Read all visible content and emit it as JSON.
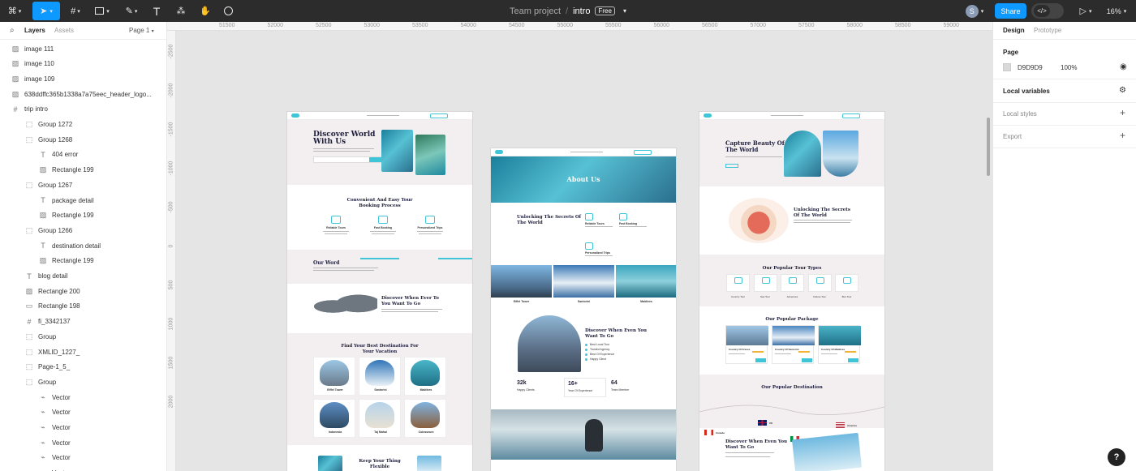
{
  "topbar": {
    "project": "Team project",
    "separator": "/",
    "file": "intro",
    "plan_badge": "Free",
    "avatar_initial": "S",
    "share": "Share",
    "zoom": "16%"
  },
  "left": {
    "tabs": {
      "layers": "Layers",
      "assets": "Assets"
    },
    "page_selector": "Page 1",
    "layers": [
      {
        "name": "image 111",
        "icon": "image-icon",
        "indent": 0
      },
      {
        "name": "image 110",
        "icon": "image-icon",
        "indent": 0
      },
      {
        "name": "image 109",
        "icon": "image-icon",
        "indent": 0
      },
      {
        "name": "638ddffc365b1338a7a75eec_header_logo...",
        "icon": "image-icon",
        "indent": 0
      },
      {
        "name": "trip intro",
        "icon": "frame-icon",
        "indent": 0
      },
      {
        "name": "Group 1272",
        "icon": "group-icon",
        "indent": 1
      },
      {
        "name": "Group 1268",
        "icon": "group-icon",
        "indent": 1
      },
      {
        "name": "404 error",
        "icon": "text-icon",
        "indent": 2
      },
      {
        "name": "Rectangle 199",
        "icon": "image-icon",
        "indent": 2
      },
      {
        "name": "Group 1267",
        "icon": "group-icon",
        "indent": 1
      },
      {
        "name": "package detail",
        "icon": "text-icon",
        "indent": 2
      },
      {
        "name": "Rectangle 199",
        "icon": "image-icon",
        "indent": 2
      },
      {
        "name": "Group 1266",
        "icon": "group-icon",
        "indent": 1
      },
      {
        "name": "destination detail",
        "icon": "text-icon",
        "indent": 2
      },
      {
        "name": "Rectangle 199",
        "icon": "image-icon",
        "indent": 2
      },
      {
        "name": "blog detail",
        "icon": "text-icon",
        "indent": 1
      },
      {
        "name": "Rectangle 200",
        "icon": "image-icon",
        "indent": 1
      },
      {
        "name": "Rectangle 198",
        "icon": "rectangle-icon",
        "indent": 1
      },
      {
        "name": "fi_3342137",
        "icon": "frame-icon",
        "indent": 1
      },
      {
        "name": "Group",
        "icon": "group-icon",
        "indent": 1
      },
      {
        "name": "XMLID_1227_",
        "icon": "group-icon",
        "indent": 1
      },
      {
        "name": "Page-1_5_",
        "icon": "group-icon",
        "indent": 1
      },
      {
        "name": "Group",
        "icon": "group-icon",
        "indent": 1
      },
      {
        "name": "Vector",
        "icon": "vector-icon",
        "indent": 2
      },
      {
        "name": "Vector",
        "icon": "vector-icon",
        "indent": 2
      },
      {
        "name": "Vector",
        "icon": "vector-icon",
        "indent": 2
      },
      {
        "name": "Vector",
        "icon": "vector-icon",
        "indent": 2
      },
      {
        "name": "Vector",
        "icon": "vector-icon",
        "indent": 2
      },
      {
        "name": "Vector",
        "icon": "vector-icon",
        "indent": 2
      }
    ]
  },
  "right": {
    "tabs": {
      "design": "Design",
      "prototype": "Prototype"
    },
    "page_label": "Page",
    "page_color_hex": "D9D9D9",
    "page_opacity": "100%",
    "local_variables": "Local variables",
    "local_styles": "Local styles",
    "export": "Export"
  },
  "ruler": {
    "top": [
      "51500",
      "52000",
      "52500",
      "53000",
      "53500",
      "54000",
      "54500",
      "55000",
      "55500",
      "56000",
      "56500",
      "57000",
      "57500",
      "58000",
      "58500",
      "59000"
    ],
    "left": [
      "-2500",
      "-2000",
      "-1500",
      "-1000",
      "-500",
      "0",
      "500",
      "1000",
      "1500",
      "2000"
    ]
  },
  "frame1": {
    "hero_title": "Discover World With Us",
    "booking_title": "Convenient And Easy Tour Booking Process",
    "booking_items": [
      "Reliable Tours",
      "Fast Booking",
      "Personalized Trips"
    ],
    "our_word": "Our Word",
    "discover_title": "Discover When Ever To You Want To Go",
    "best_dest_title": "Find Your Best Destination For Your Vacation",
    "destinations": [
      "Eiffel Tower",
      "Santorini",
      "Maldives",
      "Indonesia",
      "Taj Mahal",
      "Colosseum"
    ],
    "keep_title": "Keep Your Thing Flexible"
  },
  "frame2": {
    "banner": "About Us",
    "secrets_title": "Unlocking The Secrets Of The World",
    "features": [
      "Reliable Tours",
      "Fast Booking",
      "Personalized Trips"
    ],
    "places": [
      "Eiffel Tower",
      "Santorini",
      "Maldives"
    ],
    "discover_title": "Discover When Even You Want To Go",
    "bullets": [
      "Best Local Tour",
      "Trusted Agency",
      "Best Of Experience",
      "Happy Client"
    ],
    "stats": [
      {
        "value": "32k",
        "label": "Happy Clients"
      },
      {
        "value": "16+",
        "label": "Year Of Experience"
      },
      {
        "value": "64",
        "label": "Team Member"
      }
    ]
  },
  "frame3": {
    "hero_title": "Capture Beauty Of The World",
    "secrets_title": "Unlocking The Secrets Of The World",
    "tour_types_title": "Our Popular Tour Types",
    "tour_types": [
      "Country Tour",
      "Sea Tour",
      "Adventure",
      "Culture Tour",
      "Bus Tour"
    ],
    "package_title": "Our Popular Package",
    "packages": [
      "Country Of France",
      "Country Of Santorini",
      "Country Of Maldives"
    ],
    "dest_title": "Our Popular Destination",
    "countries": [
      "Canada",
      "UK",
      "America",
      "Malaysia"
    ],
    "discover_title": "Discover When Even You Want To Go"
  },
  "colors": {
    "accent": "#0d99ff",
    "teal": "#3fc5d8",
    "dark": "#2c2c2c"
  }
}
